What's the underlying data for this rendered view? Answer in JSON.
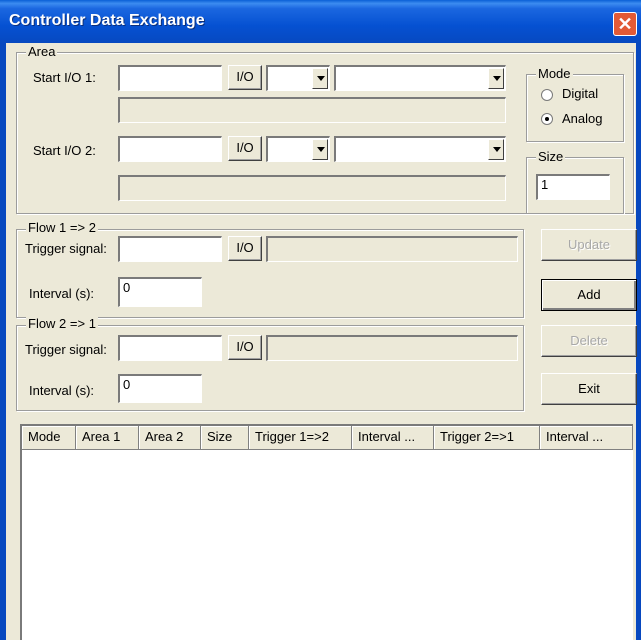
{
  "window": {
    "title": "Controller Data Exchange",
    "close_glyph": "✕"
  },
  "area": {
    "legend": "Area",
    "start1": {
      "label": "Start I/O 1:",
      "io_button": "I/O",
      "value": "",
      "dropdown1": "",
      "dropdown2": "",
      "info": ""
    },
    "start2": {
      "label": "Start I/O 2:",
      "io_button": "I/O",
      "value": "",
      "dropdown1": "",
      "dropdown2": "",
      "info": ""
    },
    "mode": {
      "legend": "Mode",
      "options": [
        "Digital",
        "Analog"
      ],
      "selected": "Analog"
    },
    "size": {
      "legend": "Size",
      "value": "1"
    }
  },
  "flow12": {
    "legend": "Flow 1 => 2",
    "trigger_label": "Trigger signal:",
    "io_button": "I/O",
    "trigger_value": "",
    "trigger_info": "",
    "interval_label": "Interval (s):",
    "interval_value": "0"
  },
  "flow21": {
    "legend": "Flow 2 => 1",
    "trigger_label": "Trigger signal:",
    "io_button": "I/O",
    "trigger_value": "",
    "trigger_info": "",
    "interval_label": "Interval (s):",
    "interval_value": "0"
  },
  "buttons": {
    "update": "Update",
    "add": "Add",
    "delete": "Delete",
    "exit": "Exit"
  },
  "table": {
    "columns": [
      "Mode",
      "Area 1",
      "Area 2",
      "Size",
      "Trigger 1=>2",
      "Interval ...",
      "Trigger 2=>1",
      "Interval ..."
    ],
    "rows": []
  },
  "colors": {
    "titlebar": "#0551d2",
    "dialog": "#ece9d8",
    "close": "#e25a36"
  }
}
